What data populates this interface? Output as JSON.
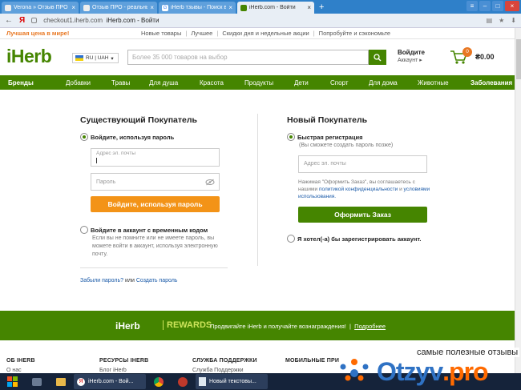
{
  "browser": {
    "tabs": [
      {
        "title": "Verona » Отзыв ПРО - реа",
        "active": false
      },
      {
        "title": "Отзыв ПРО - реальные отз",
        "active": false
      },
      {
        "title": "iHerb тзывы - Поиск в Goo",
        "active": false
      },
      {
        "title": "iHerb.com - Войти",
        "active": true
      }
    ],
    "new_tab": "+",
    "url_prefix": "checkout1.iherb.com",
    "url_title": "iHerb.com - Войти"
  },
  "promo": {
    "best_price": "Лучшая цена в мире!",
    "links": [
      "Новые товары",
      "Лучшее",
      "Скидки дня и недельные акции",
      "Попробуйте и сэкономьте"
    ]
  },
  "header": {
    "logo": "iHerb",
    "region": "RU | UAH",
    "search_placeholder": "Более 35 000 товаров на выбор",
    "login": "Войдите",
    "account": "Аккаунт ▸",
    "cart_count": "0",
    "cart_total": "₴0.00"
  },
  "nav": [
    "Бренды",
    "Добавки",
    "Травы",
    "Для душа",
    "Красота",
    "Продукты",
    "Дети",
    "Спорт",
    "Для дома",
    "Животные",
    "Заболевания"
  ],
  "existing": {
    "title": "Существующий Покупатель",
    "option_password": "Войдите, используя пароль",
    "email_placeholder": "Адрес эл. почты",
    "password_placeholder": "Пароль",
    "login_button": "Войдите, используя пароль",
    "option_code": "Войдите в аккаунт с временным кодом",
    "code_hint": "Если вы не помните или не имеете пароль, вы можете войти в аккаунт, используя электронную почту.",
    "forgot": "Забыли пароль?",
    "or": "или",
    "create": "Создать пароль"
  },
  "newcustomer": {
    "title": "Новый Покупатель",
    "option_quick": "Быстрая регистрация",
    "quick_hint": "(Вы сможете создать пароль позже)",
    "email_placeholder": "Адрес эл. почты",
    "agree_text": "Нажимая \"Оформить Заказ\", вы соглашаетесь с нашими",
    "privacy_link": "политикой конфиденциальности",
    "and": "и",
    "terms_link": "условиями использования.",
    "order_button": "Оформить Заказ",
    "option_registered": "Я хотел(-а) бы зарегистрировать аккаунт."
  },
  "rewards": {
    "logo_left": "iHerb",
    "logo_right": "REWARDS",
    "text": "Продвигайте iHerb и получайте вознаграждения!",
    "sep": "|",
    "more": "Подробнее"
  },
  "footer": {
    "cols": [
      {
        "title": "ОБ IHERB",
        "sub": "О нас"
      },
      {
        "title": "РЕСУРСЫ IHERB",
        "sub": "Блог iHerb"
      },
      {
        "title": "СЛУЖБА ПОДДЕРЖКИ",
        "sub": "Служба Поддержки"
      },
      {
        "title": "МОБИЛЬНЫЕ ПРИ",
        "sub": ""
      }
    ]
  },
  "taskbar": {
    "item1": "iHerb.com - Вой...",
    "item2": "Новый текстовы..."
  },
  "watermark": {
    "top": "самые полезные отзывы",
    "brand_main": "Otzyv",
    "brand_dot": ".pro"
  },
  "colors": {
    "green": "#458500",
    "orange": "#f39317",
    "blue": "#2f80c9"
  }
}
